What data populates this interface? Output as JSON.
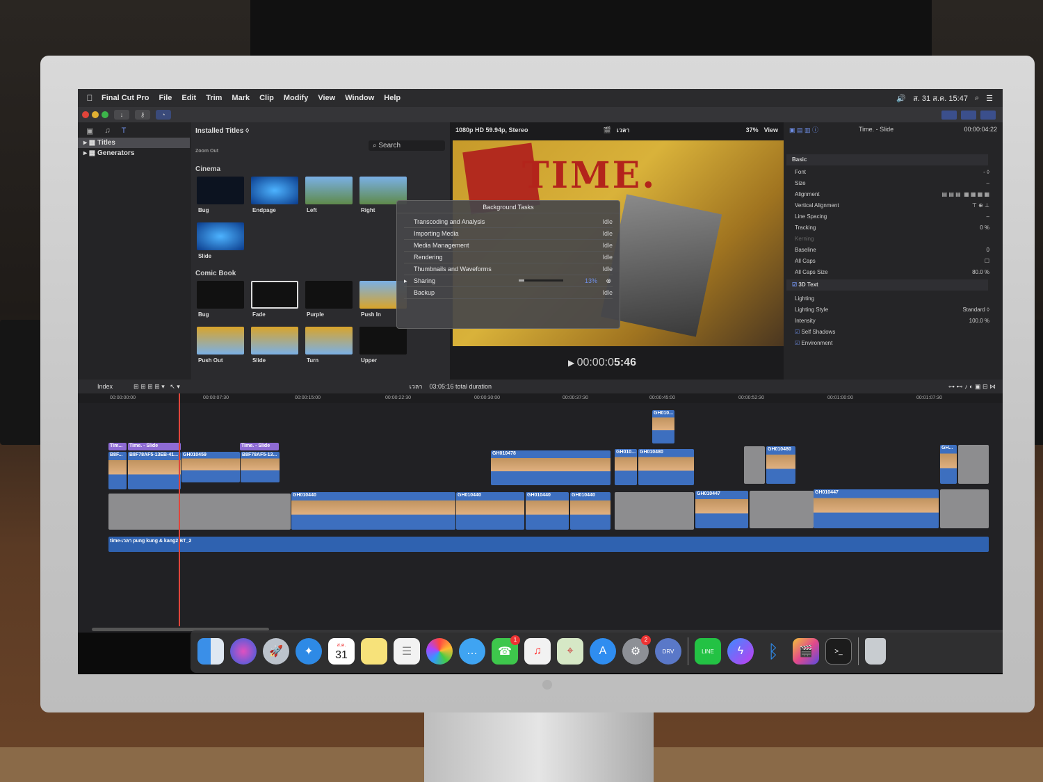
{
  "menubar": {
    "apple": "",
    "items": [
      "Final Cut Pro",
      "File",
      "Edit",
      "Trim",
      "Mark",
      "Clip",
      "Modify",
      "View",
      "Window",
      "Help"
    ],
    "datetime": "ส. 31 ส.ค. 15:47"
  },
  "sidebar": {
    "items": [
      {
        "label": "Titles",
        "selected": true
      },
      {
        "label": "Generators",
        "selected": false
      }
    ]
  },
  "browser": {
    "header": "Installed Titles",
    "search_placeholder": "Search",
    "cut_label": "Zoom Out",
    "categories": [
      {
        "name": "Cinema",
        "items": [
          "Bug",
          "Endpage",
          "Left",
          "Right",
          "Slide"
        ]
      },
      {
        "name": "Comic Book",
        "items": [
          "Bug",
          "Fade",
          "Purple",
          "Push In",
          "Push Out",
          "Slide",
          "Turn",
          "Upper"
        ]
      }
    ]
  },
  "viewer": {
    "format": "1080p HD 59.94p, Stereo",
    "project": "เวลา",
    "zoom": "37%",
    "view_label": "View",
    "timecode_prefix": "00:00:0",
    "timecode_main": "5:46"
  },
  "inspector": {
    "title": "Time. - Slide",
    "duration": "00:00:04:22",
    "basic": "Basic",
    "rows": [
      {
        "label": "Font",
        "value": "- ◊"
      },
      {
        "label": "Size",
        "value": "–"
      },
      {
        "label": "Alignment",
        "value": ""
      },
      {
        "label": "Vertical Alignment",
        "value": ""
      },
      {
        "label": "Line Spacing",
        "value": "–"
      },
      {
        "label": "Tracking",
        "value": "0 %"
      },
      {
        "label": "Kerning",
        "value": ""
      },
      {
        "label": "Baseline",
        "value": "0"
      },
      {
        "label": "All Caps",
        "value": ""
      },
      {
        "label": "All Caps Size",
        "value": "80.0 %"
      }
    ],
    "section_3d": "3D Text",
    "lighting": "Lighting",
    "lighting_style_label": "Lighting Style",
    "lighting_style_value": "Standard ◊",
    "intensity_label": "Intensity",
    "intensity_value": "100.0 %",
    "self_shadows": "Self Shadows",
    "environment": "Environment"
  },
  "dialog": {
    "title": "Background Tasks",
    "tasks": [
      {
        "name": "Transcoding and Analysis",
        "status": "Idle"
      },
      {
        "name": "Importing Media",
        "status": "Idle"
      },
      {
        "name": "Media Management",
        "status": "Idle"
      },
      {
        "name": "Rendering",
        "status": "Idle"
      },
      {
        "name": "Thumbnails and Waveforms",
        "status": "Idle"
      },
      {
        "name": "Sharing",
        "status": "13%",
        "progress": 0.13
      },
      {
        "name": "Backup",
        "status": "Idle"
      }
    ]
  },
  "timeline": {
    "index_label": "Index",
    "project": "เวลา",
    "duration": "03:05:16 total duration",
    "ruler": [
      "00:00:00:00",
      "00:00:07:30",
      "00:00:15:00",
      "00:00:22:30",
      "00:00:30:00",
      "00:00:37:30",
      "00:00:45:00",
      "00:00:52:30",
      "00:01:00:00",
      "00:01:07:30"
    ],
    "title_clips": [
      "Tim...",
      "Time. - Slide",
      "Time. - Slide"
    ],
    "clips": [
      "B8F...",
      "B8F78AF5-13EB-41...",
      "GH010459",
      "B8F78AF5-13...",
      "GH010478",
      "GH010...",
      "GH010480",
      "GH010...",
      "GH010480",
      "GH...",
      "GH010440",
      "GH010440",
      "GH010440",
      "GH010440",
      "GH010447",
      "GH010447"
    ],
    "audio": "time-เวลา pung kung & kang2 BT_2"
  },
  "dock": {
    "calendar_month": "ส.ค.",
    "calendar_day": "31",
    "facetime_badge": "1",
    "prefs_badge": "2"
  }
}
